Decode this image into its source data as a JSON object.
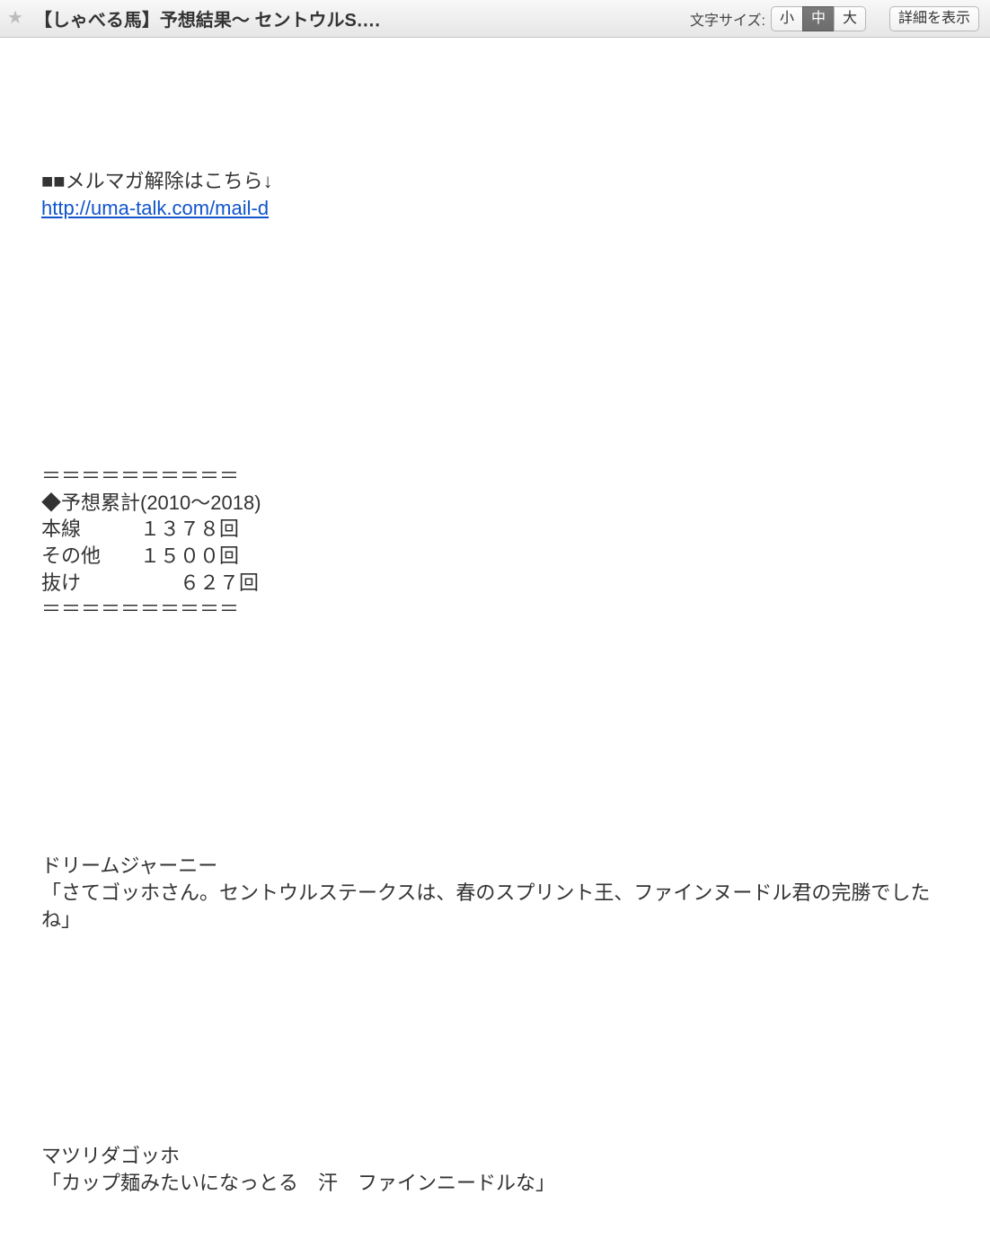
{
  "header": {
    "title": "【しゃべる馬】予想結果～ セントウルS‥‥",
    "fontsize_label": "文字サイズ:",
    "size_small": "小",
    "size_medium": "中",
    "size_large": "大",
    "details_label": "詳細を表示"
  },
  "body": {
    "unsubscribe_label": "■■メルマガ解除はこちら↓",
    "unsubscribe_url_text": "http://uma-talk.com/mail-d",
    "divider": "＝＝＝＝＝＝＝＝＝＝",
    "stats_heading": "◆予想累計(2010～2018)",
    "stats_rows": [
      {
        "label": "本線",
        "value": "１３７８回",
        "spaces": "　　　"
      },
      {
        "label": "その他",
        "value": "１５００回",
        "spaces": "　　"
      },
      {
        "label": "抜け",
        "value": "６２７回",
        "spaces": "　　　　　"
      }
    ],
    "speaker1_name": "ドリームジャーニー",
    "speaker1_line": "「さてゴッホさん。セントウルステークスは、春のスプリント王、ファインヌードル君の完勝でしたね」",
    "speaker2_name": "マツリダゴッホ",
    "speaker2_line": "「カップ麺みたいになっとる　汗　ファインニードルな」"
  }
}
